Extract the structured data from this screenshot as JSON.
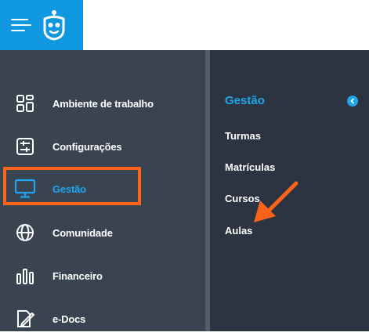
{
  "header": {
    "menu_icon": "hamburger-menu-icon",
    "logo_icon": "owl-logo-icon",
    "brand_color": "#0f98df"
  },
  "sidebar": {
    "items": [
      {
        "label": "Ambiente de trabalho",
        "icon": "dashboard-grid-icon"
      },
      {
        "label": "Configurações",
        "icon": "sliders-settings-icon"
      },
      {
        "label": "Gestão",
        "icon": "monitor-icon",
        "active": true
      },
      {
        "label": "Comunidade",
        "icon": "globe-icon"
      },
      {
        "label": "Financeiro",
        "icon": "bar-chart-icon"
      },
      {
        "label": "e-Docs",
        "icon": "document-edit-icon"
      }
    ],
    "active_color": "#1ea6ef",
    "highlight_color": "#f9641a"
  },
  "submenu": {
    "title": "Gestão",
    "collapse_icon": "chevron-left-icon",
    "items": [
      "Turmas",
      "Matrículas",
      "Cursos",
      "Aulas"
    ]
  },
  "annotation": {
    "arrow_icon": "orange-arrow-icon",
    "arrow_color": "#f9641a",
    "points_to": "Aulas"
  }
}
